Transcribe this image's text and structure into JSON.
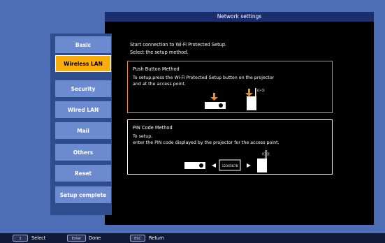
{
  "window": {
    "title": "Network settings"
  },
  "menu": {
    "items": [
      {
        "label": "Basic",
        "active": false
      },
      {
        "label": "Wireless LAN",
        "active": true
      },
      {
        "label": "Security",
        "active": false
      },
      {
        "label": "Wired LAN",
        "active": false
      },
      {
        "label": "Mail",
        "active": false
      },
      {
        "label": "Others",
        "active": false
      },
      {
        "label": "Reset",
        "active": false
      },
      {
        "label": "Setup complete",
        "active": false
      }
    ]
  },
  "content": {
    "intro_line1": "Start connection to Wi-Fi Protected Setup.",
    "intro_line2": "Select the setup method.",
    "push": {
      "title": "Push Button Method",
      "desc_line1": "To setup,press the Wi-Fi Protected Setup button on the projector",
      "desc_line2": "and at the access point.",
      "signal_label": "((•))"
    },
    "pin": {
      "title": "PIN Code Method",
      "desc_line1": "To setup,",
      "desc_line2": "enter the PIN code displayed by the projector for the access point.",
      "pin_code": "12345678",
      "signal_label": "((•))"
    },
    "accent_color": "#f9ad0a",
    "arrow_color": "#f0901c"
  },
  "bottom_bar": {
    "select_key": "↕",
    "select_label": "Select",
    "enter_key": "Enter",
    "done_label": "Done",
    "esc_key": "ESC",
    "return_label": "Return"
  }
}
